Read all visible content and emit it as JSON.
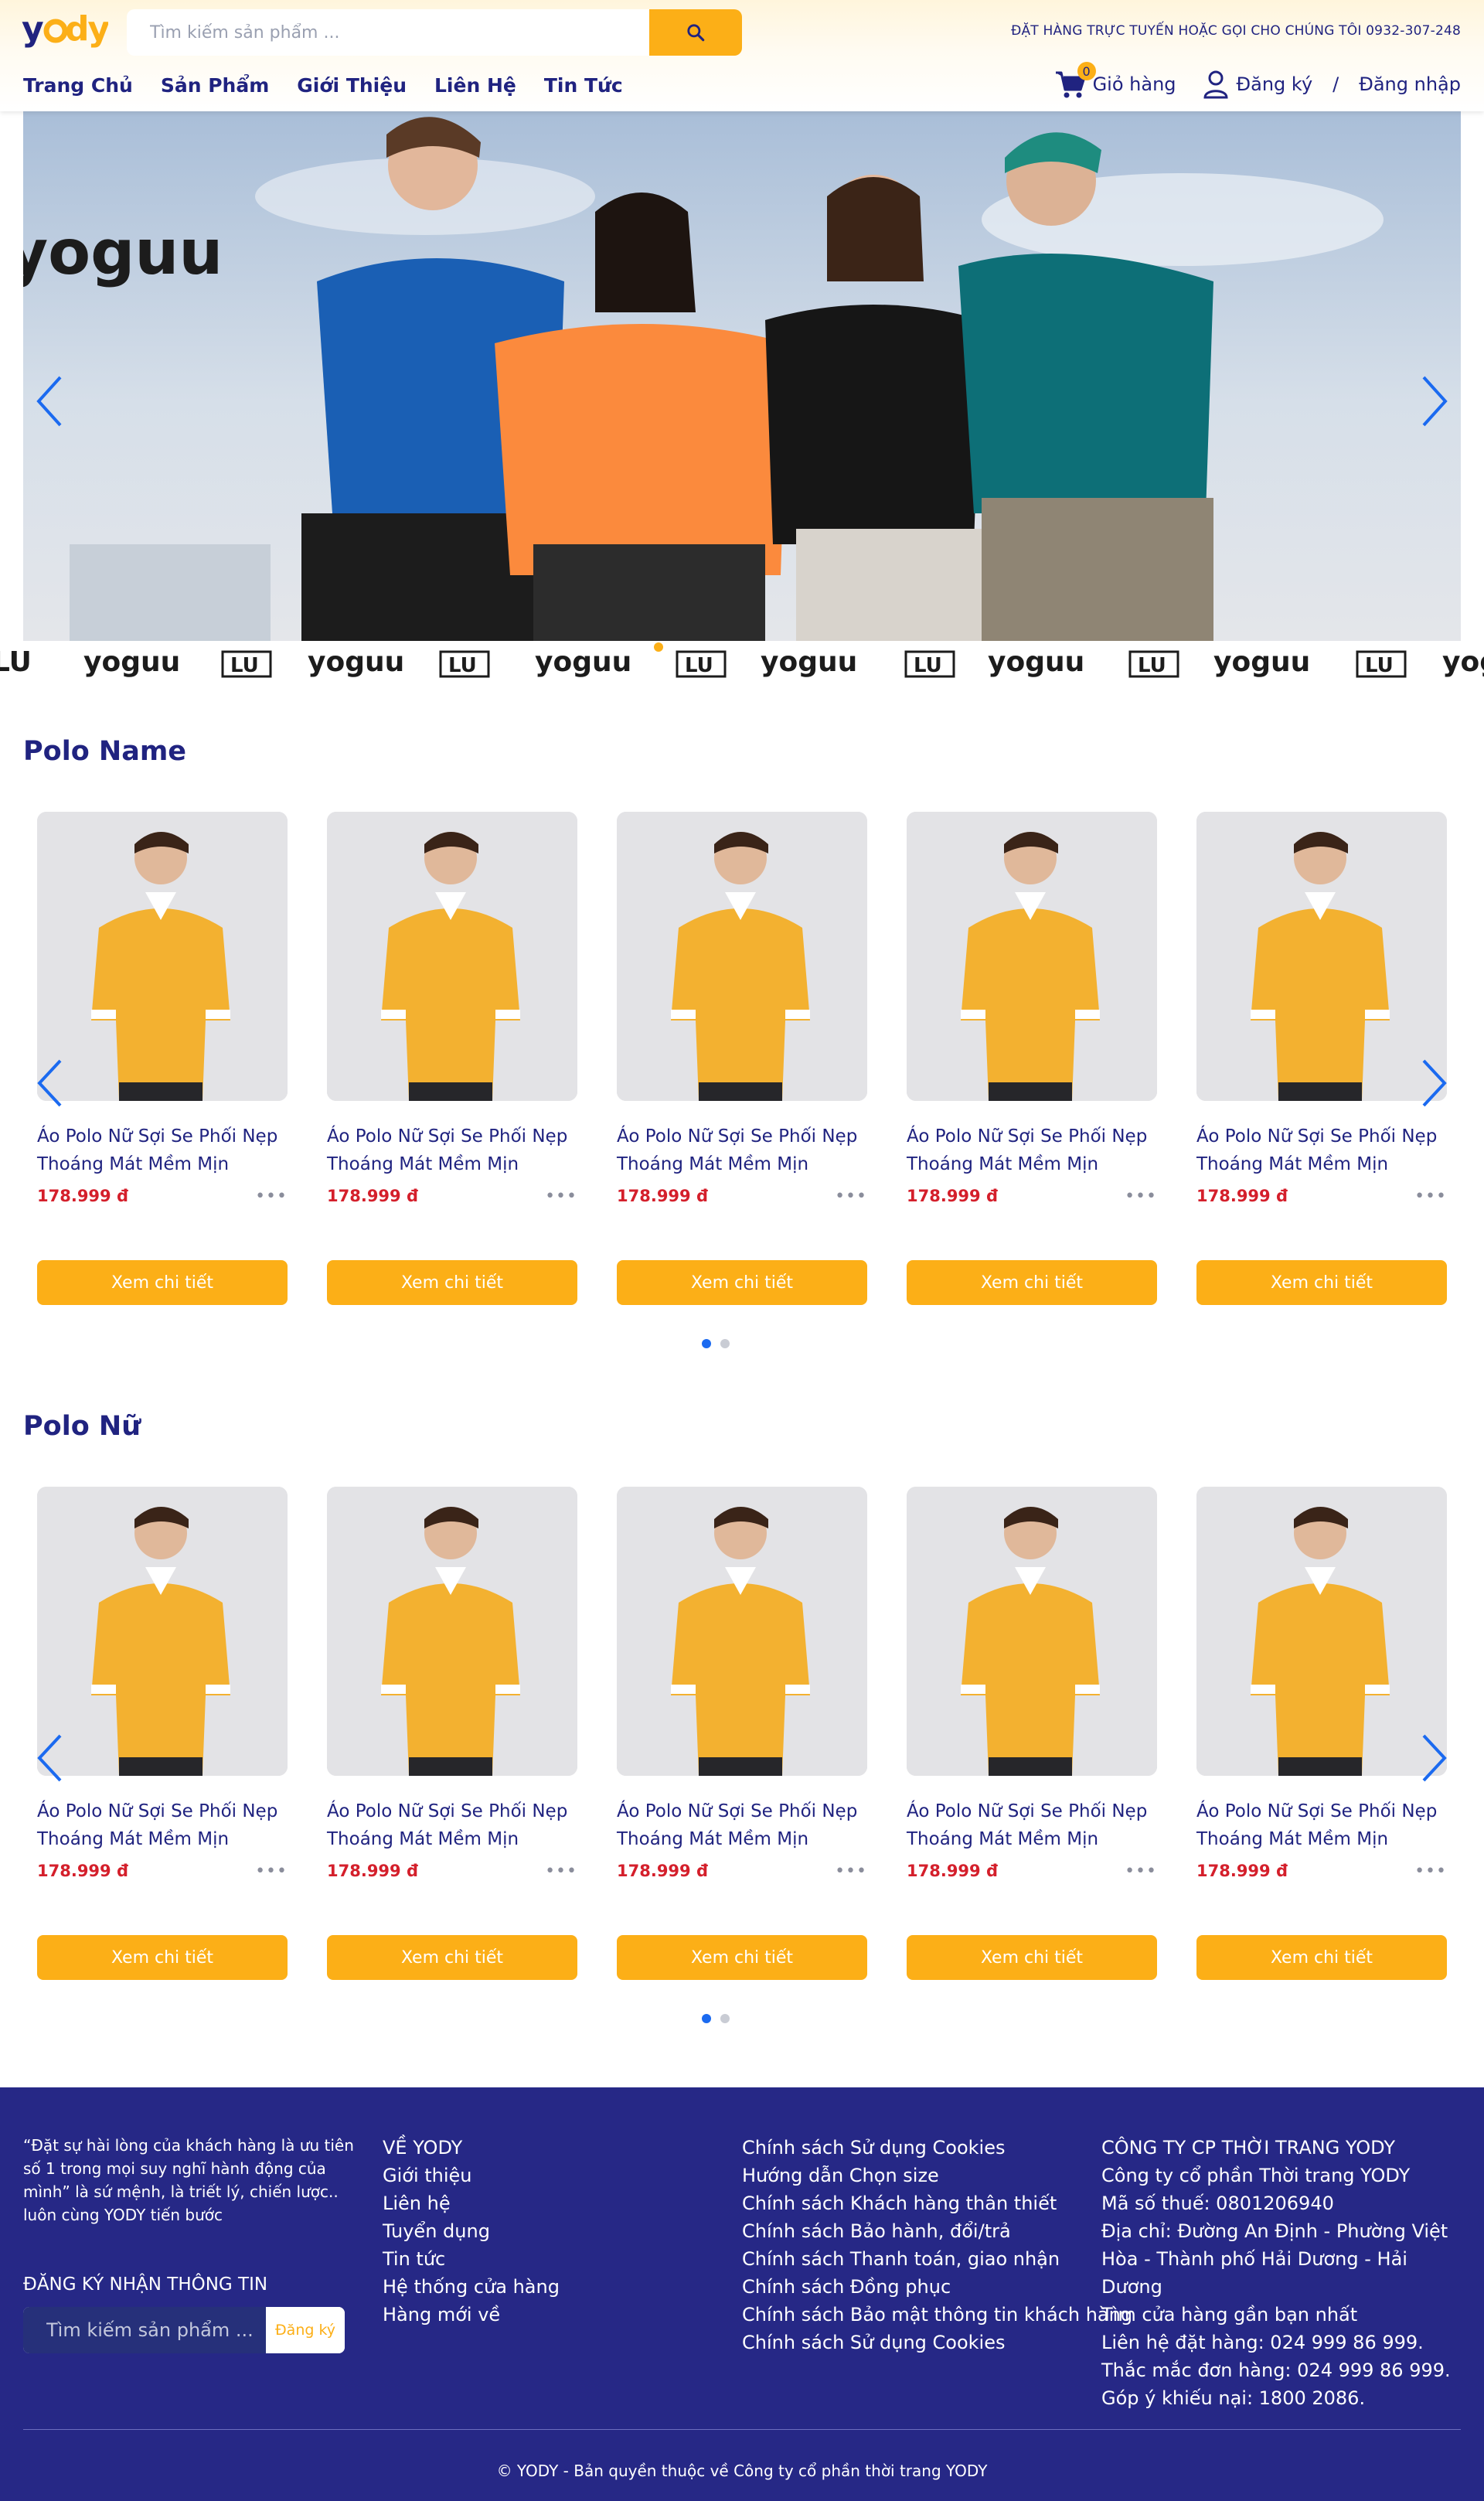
{
  "brand": {
    "name": "yody",
    "accent": "#fcaf17",
    "primary": "#202380",
    "price_color": "#d41f2b"
  },
  "search": {
    "placeholder": "Tìm kiếm sản phẩm ..."
  },
  "header": {
    "hotline": "ĐẶT HÀNG TRỰC TUYẾN HOẶC GỌI CHO CHÚNG TÔI 0932-307-248",
    "cart_count": "0",
    "cart_label": "Giỏ hàng",
    "register": "Đăng ký",
    "separator": "/",
    "login": "Đăng nhập"
  },
  "nav": {
    "items": [
      {
        "label": "Trang Chủ"
      },
      {
        "label": "Sản Phẩm"
      },
      {
        "label": "Giới Thiệu"
      },
      {
        "label": "Liên Hệ"
      },
      {
        "label": "Tin Tức"
      }
    ]
  },
  "banner": {
    "brand_text": "yoguu",
    "strip_word": "yoguu",
    "strip_mark": "LU"
  },
  "sections": [
    {
      "title": "Polo Name",
      "products": [
        {
          "name": "Áo Polo Nữ Sợi Se Phối Nẹp Thoáng Mát Mềm Mịn",
          "price": "178.999 đ",
          "more": "•••",
          "button": "Xem chi tiết"
        },
        {
          "name": "Áo Polo Nữ Sợi Se Phối Nẹp Thoáng Mát Mềm Mịn",
          "price": "178.999 đ",
          "more": "•••",
          "button": "Xem chi tiết"
        },
        {
          "name": "Áo Polo Nữ Sợi Se Phối Nẹp Thoáng Mát Mềm Mịn",
          "price": "178.999 đ",
          "more": "•••",
          "button": "Xem chi tiết"
        },
        {
          "name": "Áo Polo Nữ Sợi Se Phối Nẹp Thoáng Mát Mềm Mịn",
          "price": "178.999 đ",
          "more": "•••",
          "button": "Xem chi tiết"
        },
        {
          "name": "Áo Polo Nữ Sợi Se Phối Nẹp Thoáng Mát Mềm Mịn",
          "price": "178.999 đ",
          "more": "•••",
          "button": "Xem chi tiết"
        }
      ]
    },
    {
      "title": "Polo Nữ",
      "products": [
        {
          "name": "Áo Polo Nữ Sợi Se Phối Nẹp Thoáng Mát Mềm Mịn",
          "price": "178.999 đ",
          "more": "•••",
          "button": "Xem chi tiết"
        },
        {
          "name": "Áo Polo Nữ Sợi Se Phối Nẹp Thoáng Mát Mềm Mịn",
          "price": "178.999 đ",
          "more": "•••",
          "button": "Xem chi tiết"
        },
        {
          "name": "Áo Polo Nữ Sợi Se Phối Nẹp Thoáng Mát Mềm Mịn",
          "price": "178.999 đ",
          "more": "•••",
          "button": "Xem chi tiết"
        },
        {
          "name": "Áo Polo Nữ Sợi Se Phối Nẹp Thoáng Mát Mềm Mịn",
          "price": "178.999 đ",
          "more": "•••",
          "button": "Xem chi tiết"
        },
        {
          "name": "Áo Polo Nữ Sợi Se Phối Nẹp Thoáng Mát Mềm Mịn",
          "price": "178.999 đ",
          "more": "•••",
          "button": "Xem chi tiết"
        }
      ]
    }
  ],
  "footer": {
    "quote": "“Đặt sự hài lòng của khách hàng là ưu tiên số 1 trong mọi suy nghĩ hành động của mình” là sứ mệnh, là triết lý, chiến lược.. luôn cùng YODY tiến bước",
    "subscribe_title": "ĐĂNG KÝ NHẬN THÔNG TIN",
    "subscribe_placeholder": "Tìm kiếm sản phẩm ...",
    "subscribe_button": "Đăng ký",
    "about_links": [
      "VỀ YODY",
      "Giới thiệu",
      "Liên hệ",
      "Tuyển dụng",
      "Tin tức",
      "Hệ thống cửa hàng",
      "Hàng mới về"
    ],
    "policy_links": [
      "Chính sách Sử dụng Cookies",
      "Hướng dẫn Chọn size",
      "Chính sách Khách hàng thân thiết",
      "Chính sách Bảo hành, đổi/trả",
      "Chính sách Thanh toán, giao nhận",
      "Chính sách Đồng phục",
      "Chính sách Bảo mật thông tin khách hàng",
      "Chính sách Sử dụng Cookies"
    ],
    "company_lines": [
      "CÔNG TY CP THỜI TRANG YODY",
      "Công ty cổ phần Thời trang YODY",
      "Mã số thuế: 0801206940",
      "Địa chỉ: Đường An Định - Phường Việt Hòa - Thành phố Hải Dương - Hải Dương",
      "Tìm cửa hàng gần bạn nhất",
      "Liên hệ đặt hàng: 024 999 86 999.",
      "Thắc mắc đơn hàng: 024 999 86 999.",
      "Góp ý khiếu nại: 1800 2086."
    ],
    "copyright": "© YODY - Bản quyền thuộc về Công ty cổ phần thời trang YODY"
  }
}
